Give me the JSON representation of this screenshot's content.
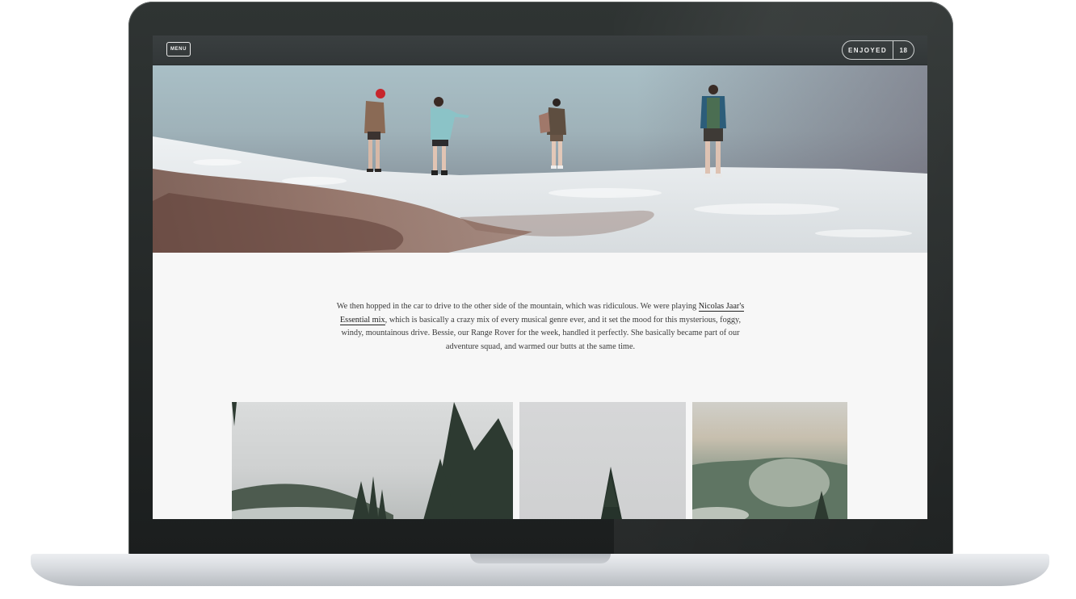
{
  "header": {
    "menu_label": "MENU",
    "enjoyed_label": "ENJOYED",
    "enjoyed_count": "18"
  },
  "story": {
    "text_before_link": "We then hopped in the car to drive to the other side of the mountain, which was ridiculous. We were playing ",
    "link_label": "Nicolas Jaar's Essential mix",
    "text_after_link": ", which is basically a crazy mix of every musical genre ever, and it set the mood for this mysterious, foggy, windy, mountainous drive. Bessie, our Range Rover for the week, handled it perfectly. She basically became part of our adventure squad, and warmed our butts at the same time."
  },
  "icons": {
    "menu": "menu-icon"
  },
  "colors": {
    "header_bg": "#363b3c",
    "page_bg": "#f7f7f7",
    "laptop_frame": "#1f2323",
    "text": "#3a3a3a"
  }
}
